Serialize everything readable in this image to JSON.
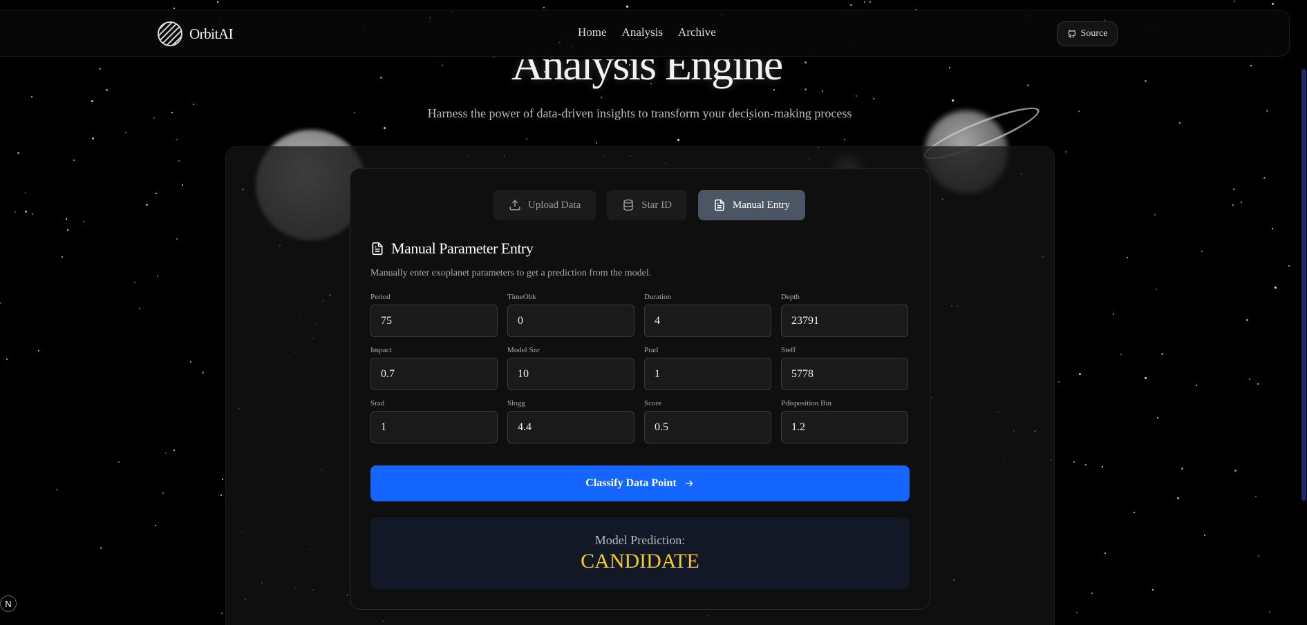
{
  "brand": {
    "name": "OrbitAI"
  },
  "nav": {
    "links": [
      "Home",
      "Analysis",
      "Archive"
    ],
    "source_label": "Source"
  },
  "hero": {
    "title": "Analysis Engine",
    "subtitle": "Harness the power of data-driven insights to transform your decision-making process"
  },
  "tabs": [
    {
      "label": "Upload Data",
      "icon": "upload-icon",
      "active": false
    },
    {
      "label": "Star ID",
      "icon": "database-icon",
      "active": false
    },
    {
      "label": "Manual Entry",
      "icon": "document-icon",
      "active": true
    }
  ],
  "manual": {
    "title": "Manual Parameter Entry",
    "description": "Manually enter exoplanet parameters to get a prediction from the model.",
    "fields": [
      {
        "label": "Period",
        "value": "75"
      },
      {
        "label": "TimeObk",
        "value": "0"
      },
      {
        "label": "Duration",
        "value": "4"
      },
      {
        "label": "Depth",
        "value": "23791"
      },
      {
        "label": "Impact",
        "value": "0.7"
      },
      {
        "label": "Model Snr",
        "value": "10"
      },
      {
        "label": "Prad",
        "value": "1"
      },
      {
        "label": "Steff",
        "value": "5778"
      },
      {
        "label": "Srad",
        "value": "1"
      },
      {
        "label": "Slogg",
        "value": "4.4"
      },
      {
        "label": "Score",
        "value": "0.5"
      },
      {
        "label": "Pdisposition Bin",
        "value": "1.2"
      }
    ],
    "classify_label": "Classify Data Point"
  },
  "result": {
    "label": "Model Prediction:",
    "value": "CANDIDATE"
  },
  "colors": {
    "accent": "#1565ff",
    "prediction": "#facc15",
    "active_tab": "#4b5563"
  },
  "badge": "N"
}
